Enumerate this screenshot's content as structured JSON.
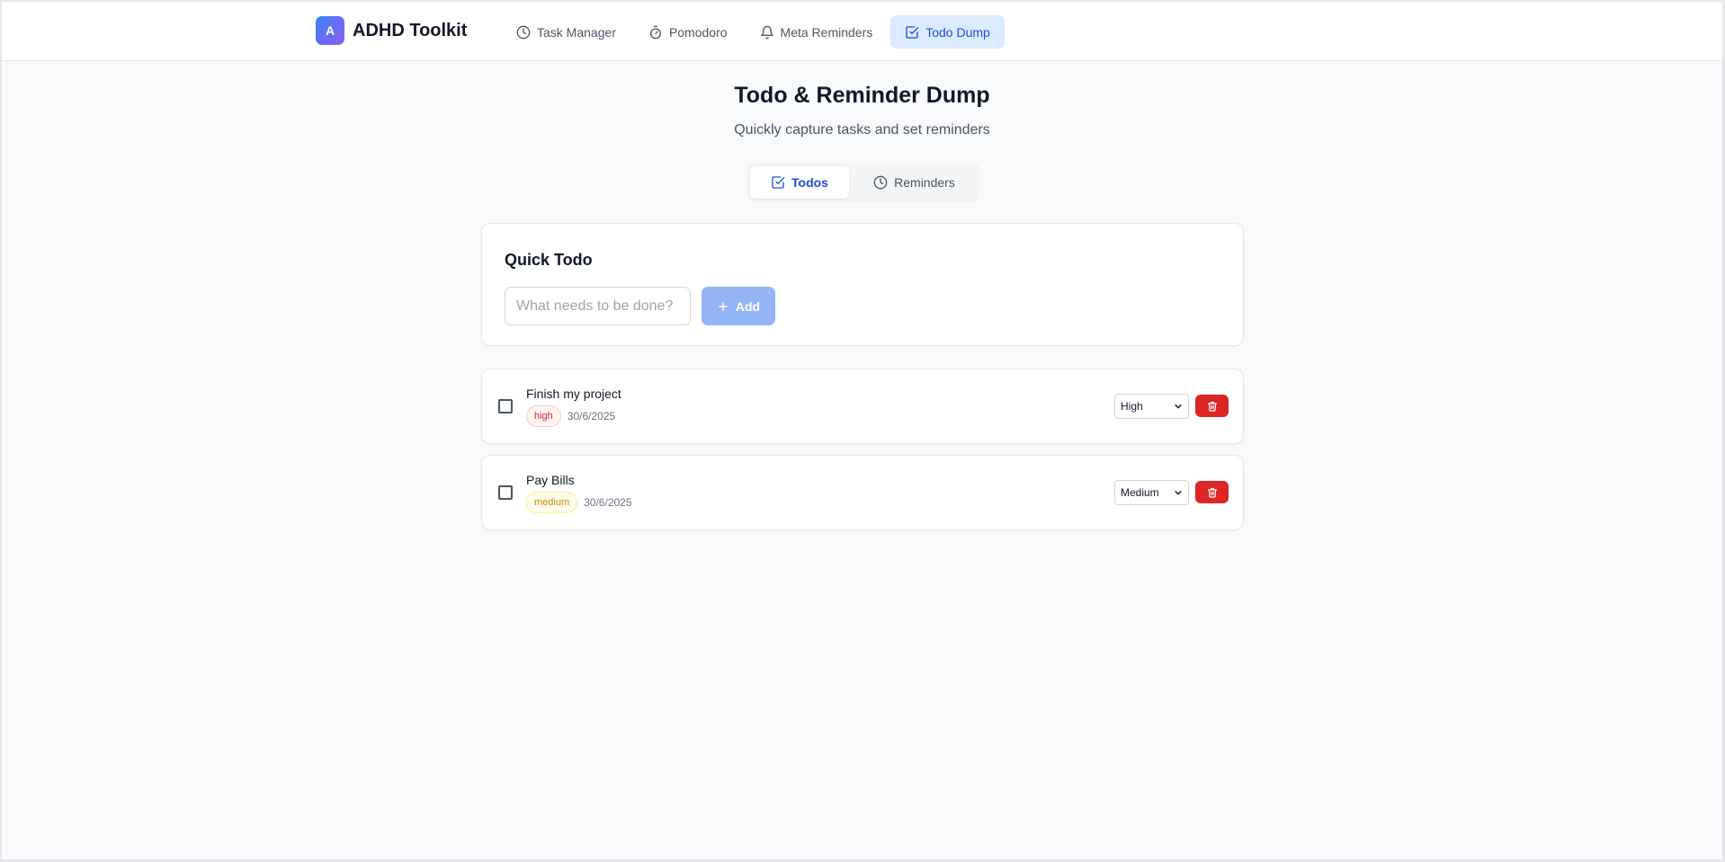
{
  "app": {
    "logo_letter": "A",
    "name": "ADHD Toolkit"
  },
  "nav": {
    "items": [
      {
        "label": "Task Manager",
        "icon": "clock-icon"
      },
      {
        "label": "Pomodoro",
        "icon": "timer-icon"
      },
      {
        "label": "Meta Reminders",
        "icon": "bell-icon"
      },
      {
        "label": "Todo Dump",
        "icon": "check-square-icon",
        "active": true
      }
    ]
  },
  "header": {
    "title": "Todo & Reminder Dump",
    "subtitle": "Quickly capture tasks and set reminders"
  },
  "tabs": {
    "todos": "Todos",
    "reminders": "Reminders",
    "active": "Todos"
  },
  "quick_todo": {
    "title": "Quick Todo",
    "placeholder": "What needs to be done?",
    "value": "",
    "add_label": "Add"
  },
  "todos": [
    {
      "text": "Finish my project",
      "priority_badge": "high",
      "date": "30/6/2025",
      "priority_select": "High",
      "completed": false
    },
    {
      "text": "Pay Bills",
      "priority_badge": "medium",
      "date": "30/6/2025",
      "priority_select": "Medium",
      "completed": false
    }
  ],
  "colors": {
    "accent": "#2563eb",
    "active_nav_bg": "#dbeafe",
    "danger": "#dc2626",
    "high_badge": "#dc2626",
    "medium_badge": "#ca8a04",
    "add_button_disabled": "#93b4f5"
  }
}
